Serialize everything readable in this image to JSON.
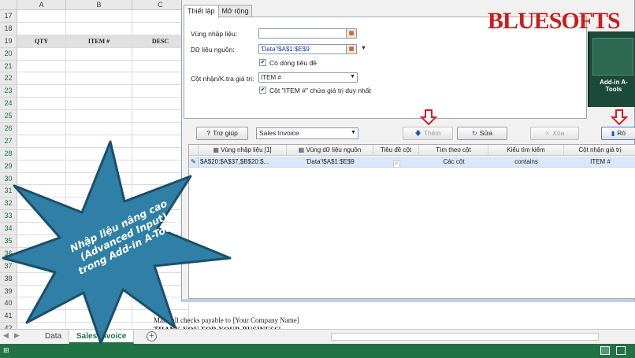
{
  "sheet": {
    "columns": [
      "A",
      "B",
      "C"
    ],
    "rows": [
      "17",
      "18",
      "19",
      "20",
      "21",
      "22",
      "23",
      "24",
      "25",
      "26",
      "27",
      "28",
      "29",
      "30",
      "31",
      "32",
      "33",
      "34",
      "35",
      "36",
      "37",
      "38",
      "39",
      "40",
      "41",
      "42"
    ],
    "header_row": {
      "row": "19",
      "qty": "QTY",
      "item": "ITEM #",
      "desc": "DESC"
    },
    "footer_line1": "Make all checks payable to [Your Company Name]",
    "footer_line2": "THANK YOU FOR YOUR BUSINESS!",
    "tabs": [
      {
        "label": "Data"
      },
      {
        "label": "Sales Invoice"
      }
    ],
    "add_sheet": "+",
    "status_text": "⊞"
  },
  "dialog": {
    "tabs": [
      "Thiết lập",
      "Mở rộng"
    ],
    "fields": {
      "input_range_label": "Vùng nhập liệu:",
      "input_range_value": "",
      "source_label": "Dữ liệu nguồn:",
      "source_value": "'Data'!$A$1:$E$9",
      "has_header_label": "Có dòng tiêu đề",
      "has_header_checked": true,
      "match_col_label": "Cột nhận/K.tra giá trị:",
      "match_col_value": "ITEM #",
      "unique_label": "Cột \"ITEM #\" chứa giá trị duy nhất",
      "unique_checked": true
    },
    "toolbar": {
      "help": "Trợ giúp",
      "profile_select": "Sales Invoice",
      "add": "Thêm",
      "edit": "Sửa",
      "delete": "Xóa",
      "run": "Rò"
    },
    "grid": {
      "columns": [
        "Vùng nhập liệu [1]",
        "Vùng dữ liệu nguồn",
        "Tiêu đề cột",
        "Tìm theo cột",
        "Kiểu tìm kiếm",
        "Cột nhận giá trị"
      ],
      "rows": [
        {
          "input_range": "$A$20:$A$37,$B$20:$...",
          "source_range": "'Data'!$A$1:$E$9",
          "header": true,
          "search_col": "Các cột",
          "search_type": "contains",
          "result_col": "ITEM #"
        }
      ]
    }
  },
  "brand": {
    "logo": "BLUESOFTS",
    "product": "Add-in A-Tools"
  },
  "overlay": {
    "lines": [
      "Nhập liệu nâng cao",
      "(Advanced Input)",
      "trong Add-in A-Tools"
    ],
    "color": "#2f7fa6"
  }
}
